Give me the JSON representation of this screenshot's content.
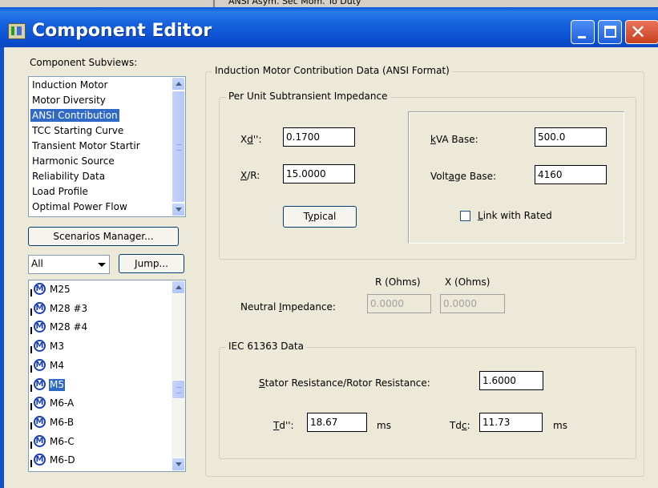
{
  "background_window": {
    "text": "ANSI Asym. Sec Mom. To Duty"
  },
  "window": {
    "title": "Component Editor"
  },
  "left_panel": {
    "subviews_label": "Component Subviews:",
    "subviews": [
      "Induction Motor",
      "Motor Diversity",
      "ANSI Contribution",
      "TCC Starting Curve",
      "Transient Motor Startir",
      "Harmonic Source",
      "Reliability Data",
      "Load Profile",
      "Optimal Power Flow"
    ],
    "selected_subview": "ANSI Contribution",
    "scenarios_button": "Scenarios Manager...",
    "filter_value": "All",
    "jump_button": "Jump...",
    "components": [
      "M25",
      "M28 #3",
      "M28 #4",
      "M3",
      "M4",
      "M5",
      "M6-A",
      "M6-B",
      "M6-C",
      "M6-D"
    ],
    "selected_component": "M5",
    "component_icon": "motor-icon"
  },
  "main": {
    "group_title": "Induction Motor Contribution Data (ANSI Format)",
    "impedance_group": {
      "title": "Per Unit Subtransient Impedance",
      "xd_label_pre": "X",
      "xd_label_u": "d",
      "xd_label_post": "'':",
      "xd_value": "0.1700",
      "xr_label_u": "X",
      "xr_label_post": "/R:",
      "xr_value": "15.0000",
      "typical_pre": "T",
      "typical_u": "y",
      "typical_post": "pical",
      "kva_label_u": "k",
      "kva_label_post": "VA Base:",
      "kva_value": "500.0",
      "voltage_label_pre": "Volt",
      "voltage_label_u": "a",
      "voltage_label_post": "ge Base:",
      "voltage_value": "4160",
      "link_label_u": "L",
      "link_label_post": "ink with Rated",
      "link_checked": false
    },
    "neutral": {
      "r_header": "R (Ohms)",
      "x_header": "X (Ohms)",
      "label_pre": "Neutral ",
      "label_u": "I",
      "label_post": "mpedance:",
      "r_value": "0.0000",
      "x_value": "0.0000"
    },
    "iec": {
      "title": "IEC 61363 Data",
      "stator_label_u": "S",
      "stator_label_post": "tator Resistance/Rotor Resistance:",
      "stator_value": "1.6000",
      "td_label_u": "T",
      "td_label_post": "d'':",
      "td_value": "18.67",
      "td_unit": "ms",
      "tdc_label_pre": "Td",
      "tdc_label_u": "c",
      "tdc_label_post": ":",
      "tdc_value": "11.73",
      "tdc_unit": "ms"
    }
  }
}
